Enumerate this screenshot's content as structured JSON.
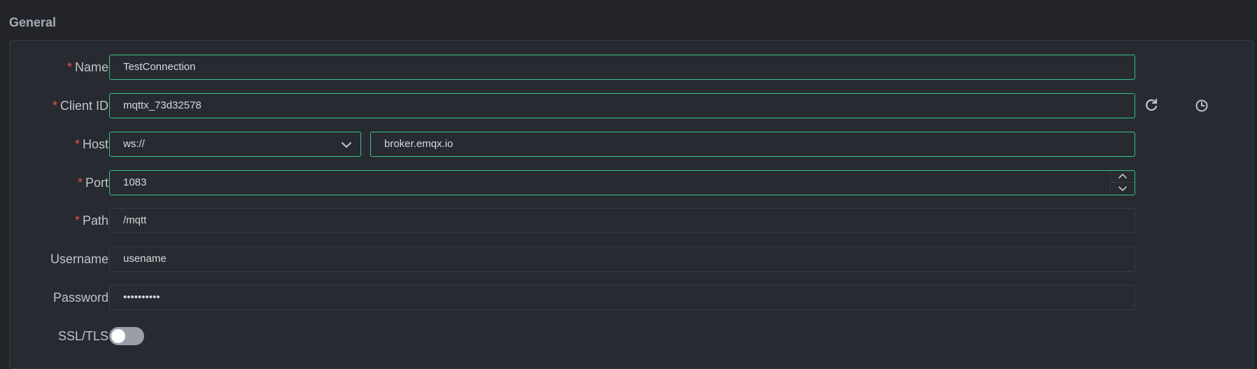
{
  "section": {
    "title": "General"
  },
  "form": {
    "name": {
      "label": "Name",
      "required": "*",
      "value": "TestConnection"
    },
    "client_id": {
      "label": "Client ID",
      "required": "*",
      "value": "mqttx_73d32578",
      "refresh_icon": "refresh-icon",
      "history_icon": "clock-icon"
    },
    "host": {
      "label": "Host",
      "required": "*",
      "protocol": "ws://",
      "value": "broker.emqx.io"
    },
    "port": {
      "label": "Port",
      "required": "*",
      "value": "1083"
    },
    "path": {
      "label": "Path",
      "required": "*",
      "value": "/mqtt"
    },
    "username": {
      "label": "Username",
      "value": "usename"
    },
    "password": {
      "label": "Password",
      "value": "••••••••••"
    },
    "ssl": {
      "label": "SSL/TLS",
      "enabled": false
    }
  },
  "colors": {
    "background": "#232429",
    "panel": "#282a31",
    "accent": "#34c388",
    "required": "#e5534b"
  }
}
